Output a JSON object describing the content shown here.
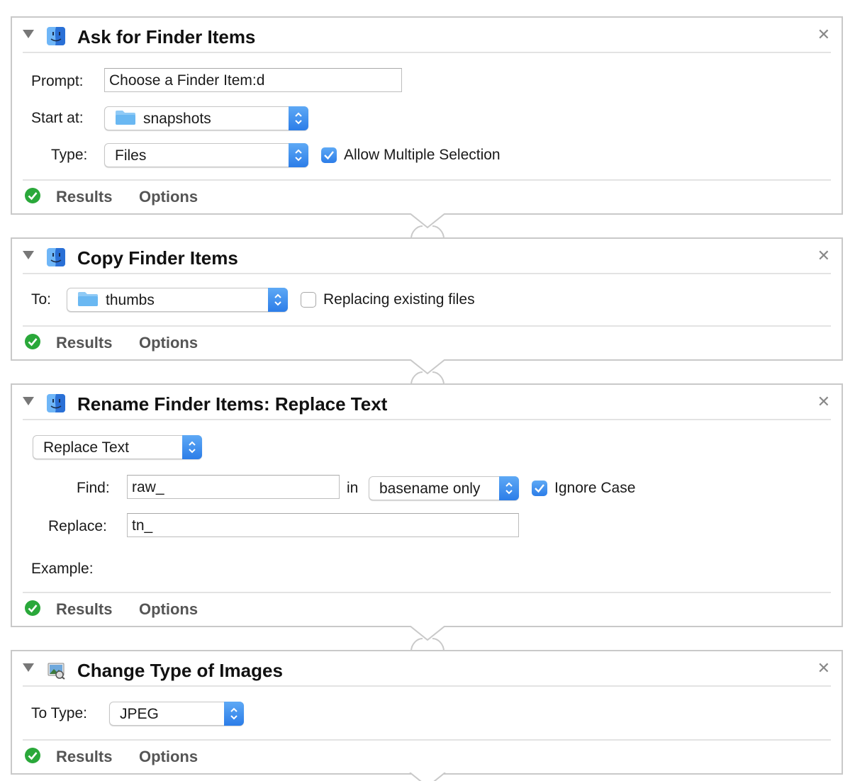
{
  "actions": [
    {
      "title": "Ask for Finder Items",
      "icon": "finder-icon",
      "prompt_label": "Prompt:",
      "prompt_value": "Choose a Finder Item:d",
      "start_label": "Start at:",
      "start_value": "snapshots",
      "type_label": "Type:",
      "type_value": "Files",
      "allow_multiple_label": "Allow Multiple Selection",
      "allow_multiple_checked": true,
      "results_label": "Results",
      "options_label": "Options"
    },
    {
      "title": "Copy Finder Items",
      "icon": "finder-icon",
      "to_label": "To:",
      "to_value": "thumbs",
      "replacing_label": "Replacing existing files",
      "replacing_checked": false,
      "results_label": "Results",
      "options_label": "Options"
    },
    {
      "title": "Rename Finder Items: Replace Text",
      "icon": "finder-icon",
      "mode_value": "Replace Text",
      "find_label": "Find:",
      "find_value": "raw_",
      "in_label": "in",
      "scope_value": "basename only",
      "ignore_case_label": "Ignore Case",
      "ignore_case_checked": true,
      "replace_label": "Replace:",
      "replace_value": "tn_",
      "example_label": "Example:",
      "results_label": "Results",
      "options_label": "Options"
    },
    {
      "title": "Change Type of Images",
      "icon": "preview-images-icon",
      "to_type_label": "To Type:",
      "to_type_value": "JPEG",
      "results_label": "Results",
      "options_label": "Options"
    }
  ],
  "colors": {
    "accent": "#2c7de8",
    "success": "#2aa83a",
    "border": "#c9c9c9"
  }
}
